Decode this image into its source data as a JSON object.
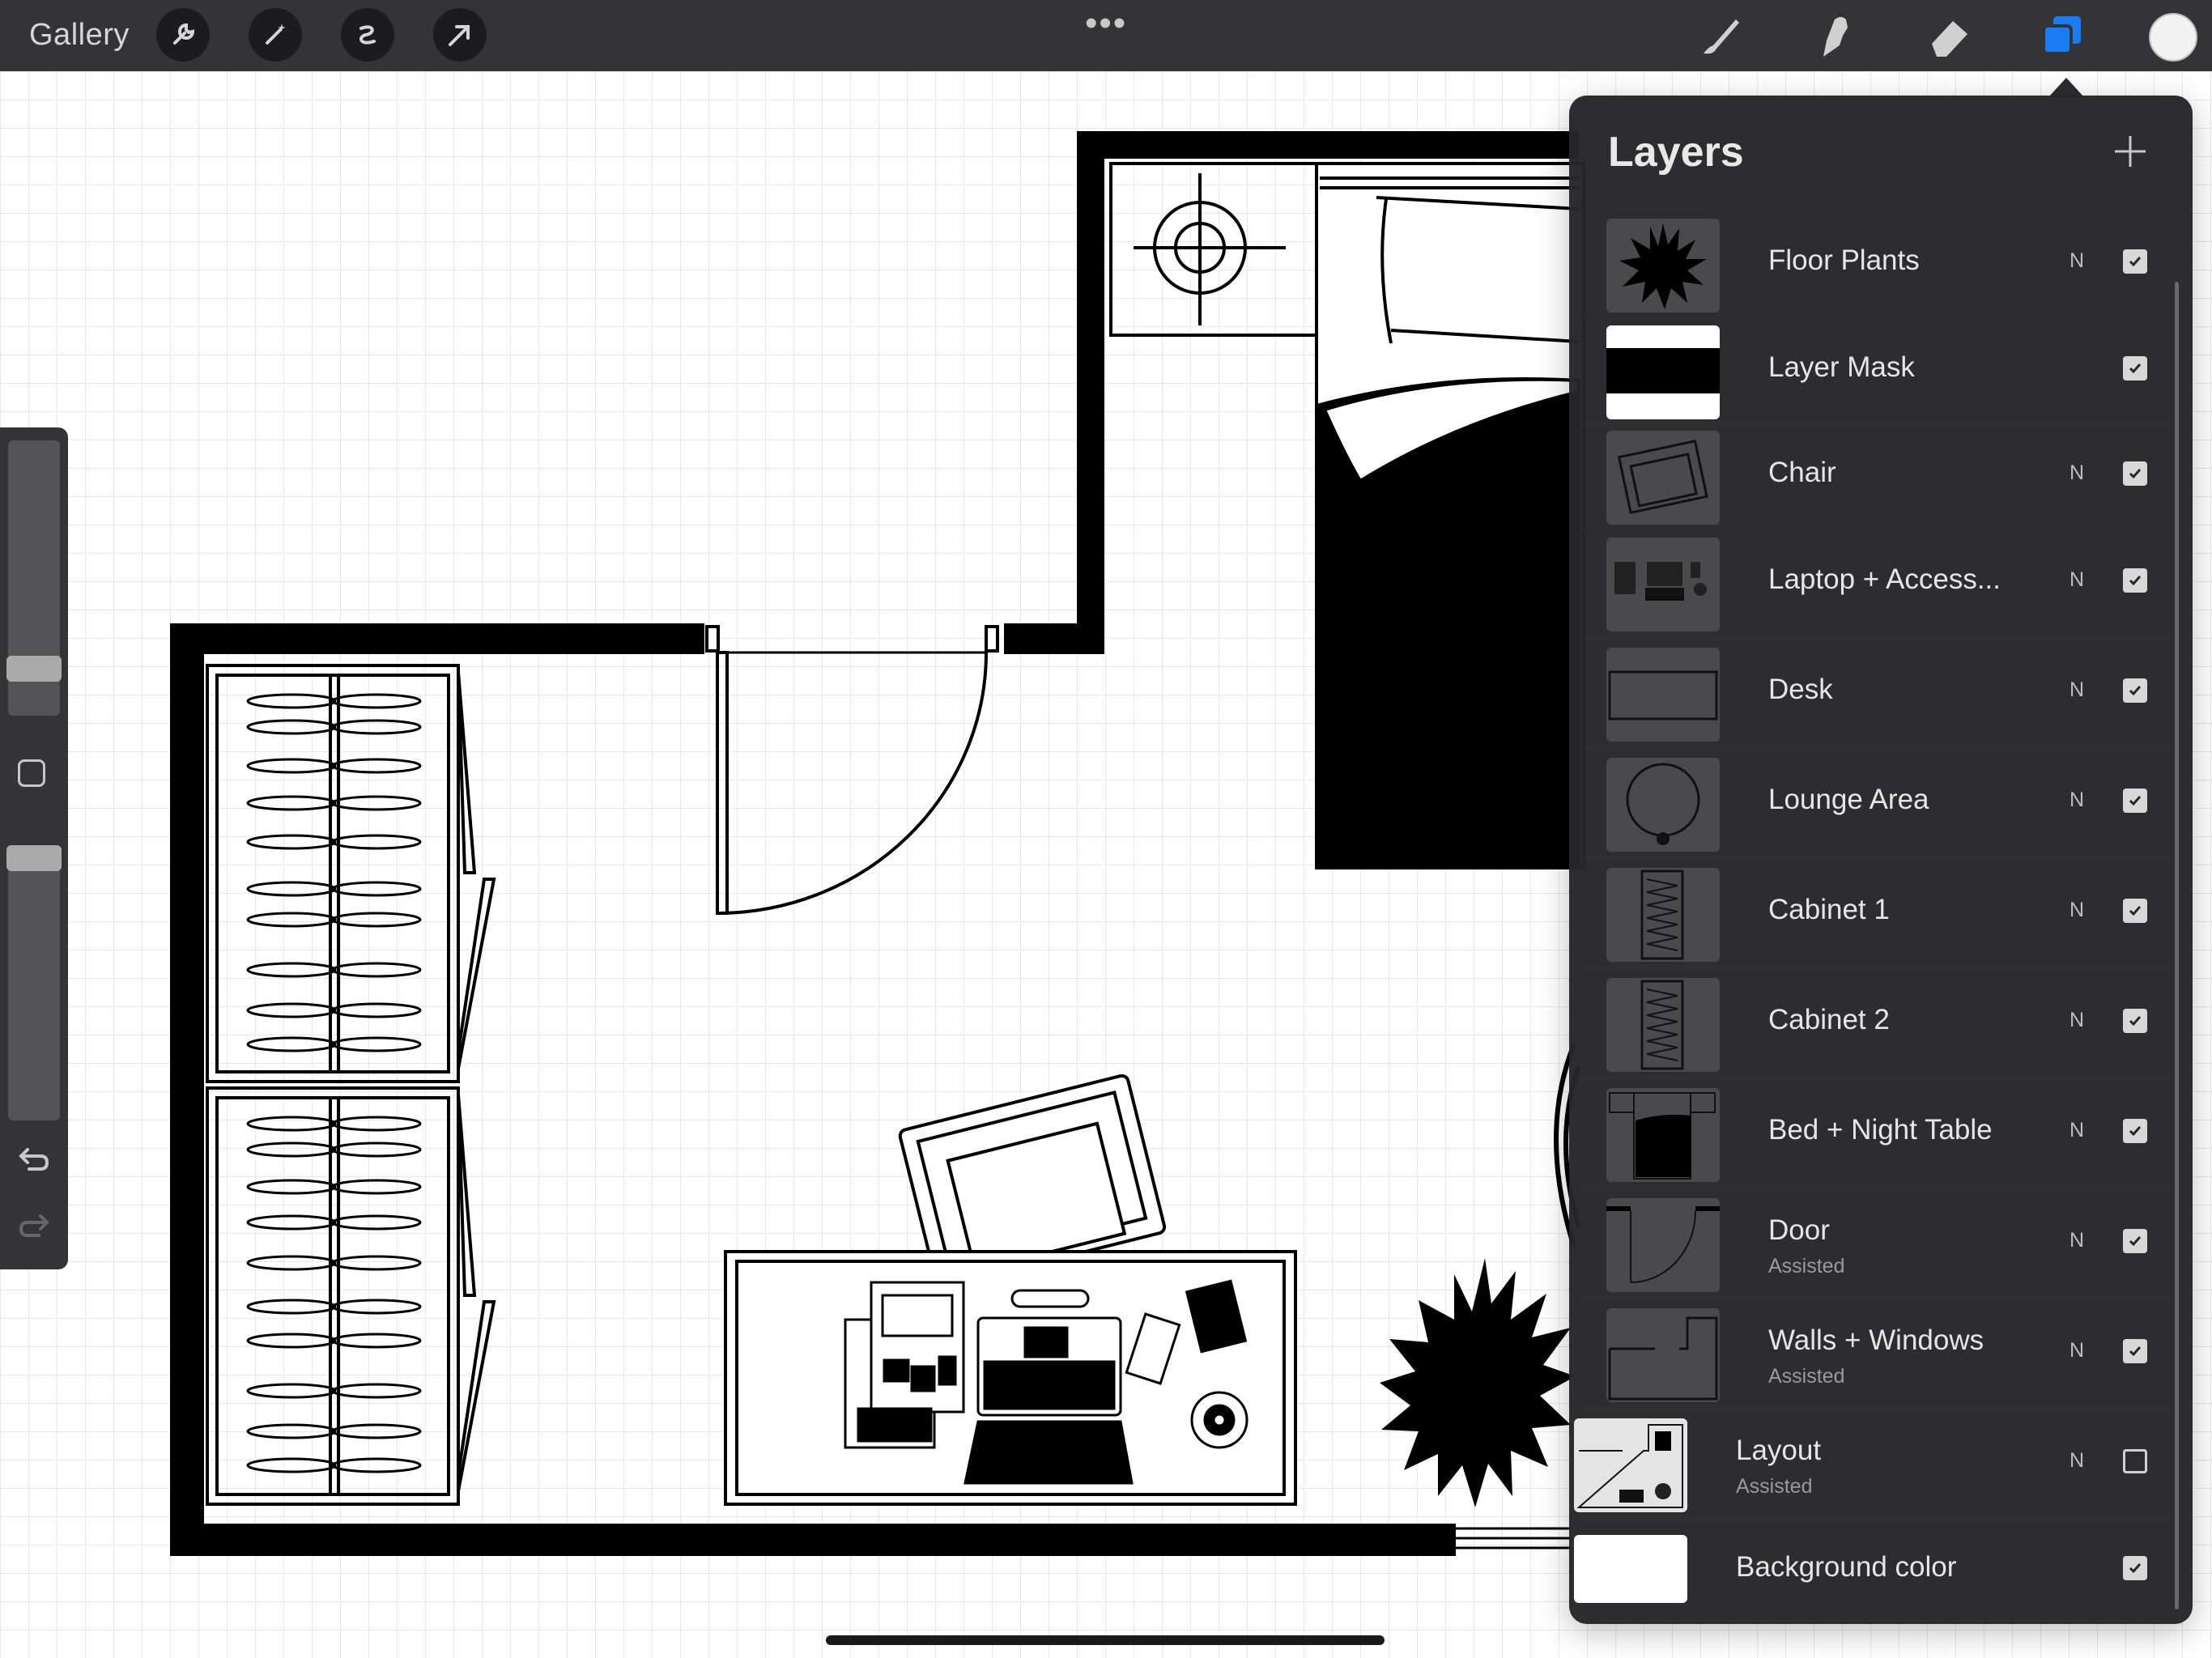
{
  "topbar": {
    "gallery_label": "Gallery",
    "tools": [
      {
        "icon": "wrench-icon"
      },
      {
        "icon": "magic-wand-icon"
      },
      {
        "icon": "selection-icon"
      },
      {
        "icon": "transform-arrow-icon"
      }
    ],
    "more_label": "•••",
    "right_tools": [
      {
        "icon": "brush-icon"
      },
      {
        "icon": "smudge-icon"
      },
      {
        "icon": "eraser-icon"
      },
      {
        "icon": "layers-icon",
        "active_color": "#1a7cf5"
      }
    ],
    "current_color": "#f2f2f2"
  },
  "sidebar": {
    "brush_size_level": 0.2,
    "opacity_level": 0.9,
    "undo_icon": "undo-icon",
    "redo_icon": "redo-icon"
  },
  "layers_panel": {
    "title": "Layers",
    "add_label": "+",
    "layers": [
      {
        "name": "Floor Plants",
        "blend": "N",
        "visible": true
      },
      {
        "name": "Layer Mask",
        "blend": "",
        "visible": true
      },
      {
        "name": "Chair",
        "blend": "N",
        "visible": true
      },
      {
        "name": "Laptop + Access...",
        "blend": "N",
        "visible": true
      },
      {
        "name": "Desk",
        "blend": "N",
        "visible": true
      },
      {
        "name": "Lounge Area",
        "blend": "N",
        "visible": true
      },
      {
        "name": "Cabinet 1",
        "blend": "N",
        "visible": true
      },
      {
        "name": "Cabinet 2",
        "blend": "N",
        "visible": true
      },
      {
        "name": "Bed + Night Table",
        "blend": "N",
        "visible": true
      },
      {
        "name": "Door",
        "sub": "Assisted",
        "blend": "N",
        "visible": true
      },
      {
        "name": "Walls + Windows",
        "sub": "Assisted",
        "blend": "N",
        "visible": true
      },
      {
        "name": "Layout",
        "sub": "Assisted",
        "blend": "N",
        "visible": false
      },
      {
        "name": "Background color",
        "blend": "",
        "visible": true
      }
    ]
  }
}
